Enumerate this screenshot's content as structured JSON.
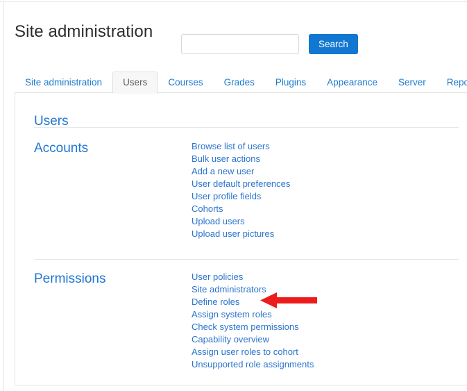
{
  "header": {
    "title": "Site administration"
  },
  "search": {
    "value": "",
    "placeholder": "",
    "button_label": "Search"
  },
  "tabs": [
    {
      "label": "Site administration",
      "active": false
    },
    {
      "label": "Users",
      "active": true
    },
    {
      "label": "Courses",
      "active": false
    },
    {
      "label": "Grades",
      "active": false
    },
    {
      "label": "Plugins",
      "active": false
    },
    {
      "label": "Appearance",
      "active": false
    },
    {
      "label": "Server",
      "active": false
    },
    {
      "label": "Reports",
      "active": false
    }
  ],
  "content": {
    "page_heading": "Users",
    "sections": [
      {
        "heading": "Accounts",
        "links": [
          "Browse list of users",
          "Bulk user actions",
          "Add a new user",
          "User default preferences",
          "User profile fields",
          "Cohorts",
          "Upload users",
          "Upload user pictures"
        ]
      },
      {
        "heading": "Permissions",
        "links": [
          "User policies",
          "Site administrators",
          "Define roles",
          "Assign system roles",
          "Check system permissions",
          "Capability overview",
          "Assign user roles to cohort",
          "Unsupported role assignments"
        ]
      }
    ]
  },
  "annotation": {
    "type": "arrow-left",
    "color": "#ec1c1c",
    "points_at": "Define roles"
  },
  "colors": {
    "link": "#2a74cd",
    "heading": "#1e76d0",
    "button": "#1177d1",
    "annotation": "#ec1c1c"
  }
}
